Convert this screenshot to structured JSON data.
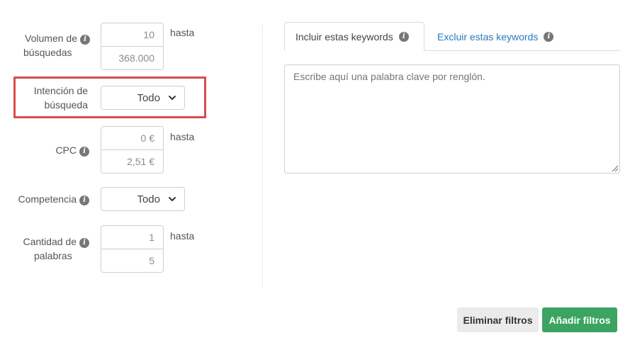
{
  "filters": {
    "volume": {
      "label_line1": "Volumen de",
      "label_line2": "búsquedas",
      "min": "10",
      "max": "368.000",
      "range_word": "hasta"
    },
    "intent": {
      "label_line1": "Intención de",
      "label_line2": "búsqueda",
      "selected": "Todo"
    },
    "cpc": {
      "label": "CPC",
      "min": "0 €",
      "max": "2,51 €",
      "range_word": "hasta"
    },
    "competition": {
      "label": "Competencia",
      "selected": "Todo"
    },
    "word_count": {
      "label_line1": "Cantidad de",
      "label_line2": "palabras",
      "min": "1",
      "max": "5",
      "range_word": "hasta"
    }
  },
  "keywords": {
    "tabs": [
      {
        "label": "Incluir estas keywords",
        "active": true
      },
      {
        "label": "Excluir estas keywords",
        "active": false
      }
    ],
    "textarea_placeholder": "Escribe aquí una palabra clave por renglón."
  },
  "actions": {
    "clear_label": "Eliminar filtros",
    "add_label": "Añadir filtros"
  },
  "colors": {
    "highlight": "#d64d4d",
    "primary_button": "#3ba461",
    "link_tab": "#2a7ab8"
  },
  "icons": {
    "info": "info-circle-icon",
    "dropdown": "chevron-down-icon",
    "resize": "resize-grip-icon"
  }
}
